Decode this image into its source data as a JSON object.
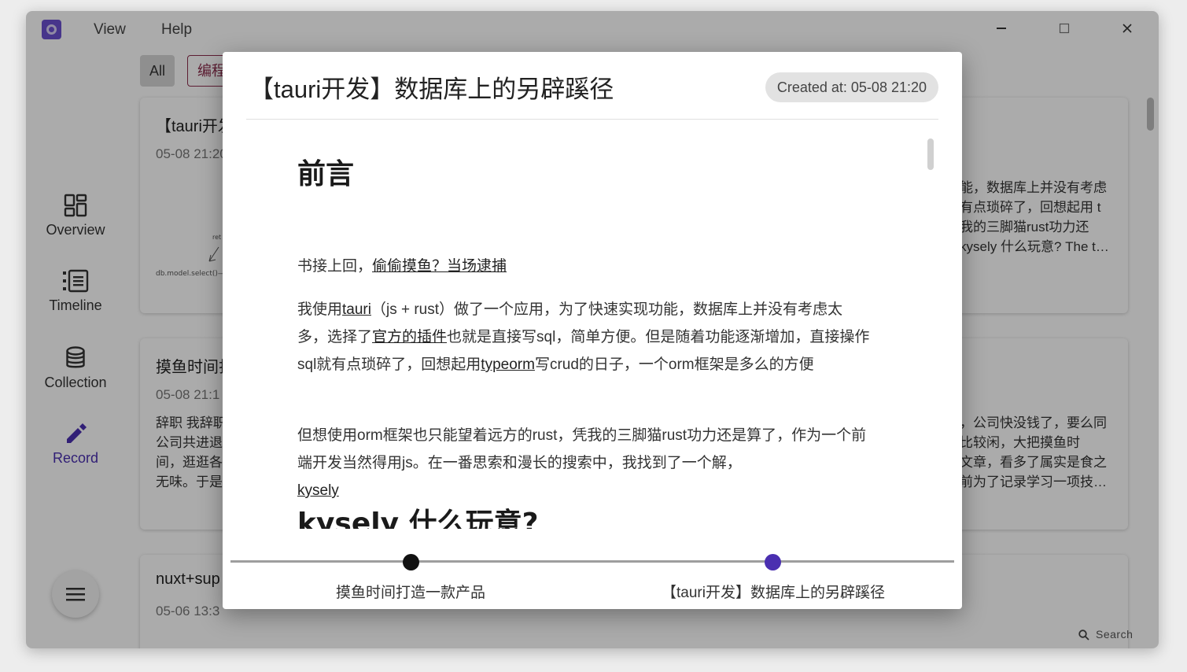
{
  "menu": {
    "view": "View",
    "help": "Help"
  },
  "window_controls": {
    "minimize": "—",
    "maximize": "☐",
    "close": "✕"
  },
  "sidebar": {
    "items": [
      {
        "label": "Overview",
        "icon": "overview-icon"
      },
      {
        "label": "Timeline",
        "icon": "timeline-icon"
      },
      {
        "label": "Collection",
        "icon": "database-icon"
      },
      {
        "label": "Record",
        "icon": "pencil-icon"
      }
    ],
    "menu_icon": "menu-icon"
  },
  "filters": {
    "all": "All",
    "tag": "编程"
  },
  "cards": [
    {
      "title": "【tauri开发】数据库上的另辟蹊径",
      "date": "05-08 21:20",
      "excerpt_left": "",
      "excerpt_right": [
        "能，数据库上并没有考虑",
        "有点琐碎了，回想起用 t",
        "我的三脚猫rust功力还",
        "kysely 什么玩意? The t…"
      ]
    },
    {
      "title": "摸鱼时间打造一款产品",
      "date": "05-08 21:1",
      "excerpt_left": [
        "辞职 我辞职",
        "公司共进退",
        "间，逛逛各",
        "无味。于是"
      ],
      "excerpt_right": [
        "，公司快没钱了，要么同",
        "比较闲，大把摸鱼时",
        "文章，看多了属实是食之",
        "前为了记录学习一项技…"
      ]
    },
    {
      "title": "nuxt+sup",
      "date": "05-06 13:3"
    }
  ],
  "search": {
    "label": "Search"
  },
  "modal": {
    "title": "【tauri开发】数据库上的另辟蹊径",
    "created": "Created at: 05-08 21:20",
    "heading1": "前言",
    "p1_text": "书接上回，",
    "p1_link": "偷偷摸鱼？当场逮捕",
    "p2": [
      "我使用",
      "tauri",
      "（js + rust）做了一个应用，为了快速实现功能，数据库上并没有考虑太多，选择了",
      "官方的插件",
      "也就是直接写sql，简单方便。但是随着功能逐渐增加，直接操作sql就有点琐碎了，回想起用",
      "typeorm",
      "写crud的日子，一个orm框架是多么的方便"
    ],
    "p3_text": "但想使用orm框架也只能望着远方的rust，凭我的三脚猫rust功力还是算了，作为一个前端开发当然得用js。在一番思索和漫长的搜索中，我找到了一个解，",
    "p3_link": "kysely",
    "heading2": "kysely 什么玩意?",
    "timeline": {
      "prev": "摸鱼时间打造一款产品",
      "current": "【tauri开发】数据库上的另辟蹊径"
    }
  },
  "colors": {
    "accent": "#4a2fb0",
    "tag": "#8b2c4c"
  }
}
